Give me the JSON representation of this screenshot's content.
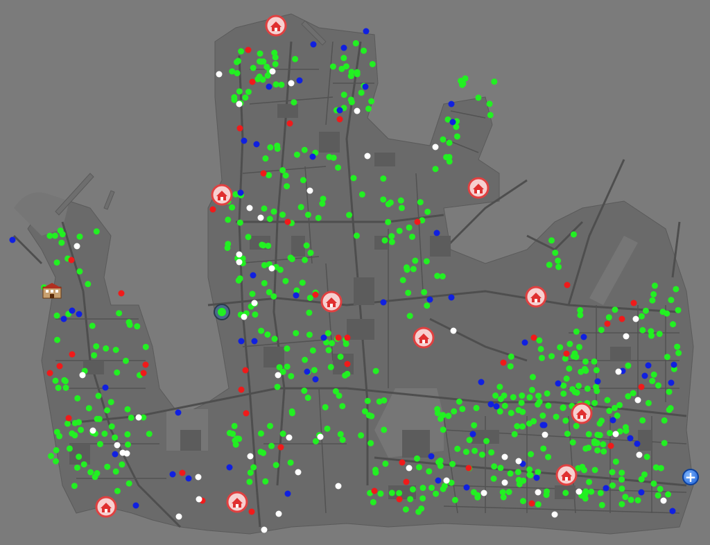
{
  "map": {
    "background_color": "#7b7b7b",
    "land_color": "#6a6a6a",
    "road_color": "#4e4e4e",
    "building_color": "#585858",
    "marker_colors": {
      "green": "#22f022",
      "red": "#f01a1a",
      "blue": "#1020e0",
      "white": "#ffffff"
    },
    "safehouse_icon": "safehouse-icon",
    "hotel_icon": "hotel-icon",
    "globe_icon": "globe-icon"
  },
  "controls": {
    "zoom_in_label": "+"
  }
}
